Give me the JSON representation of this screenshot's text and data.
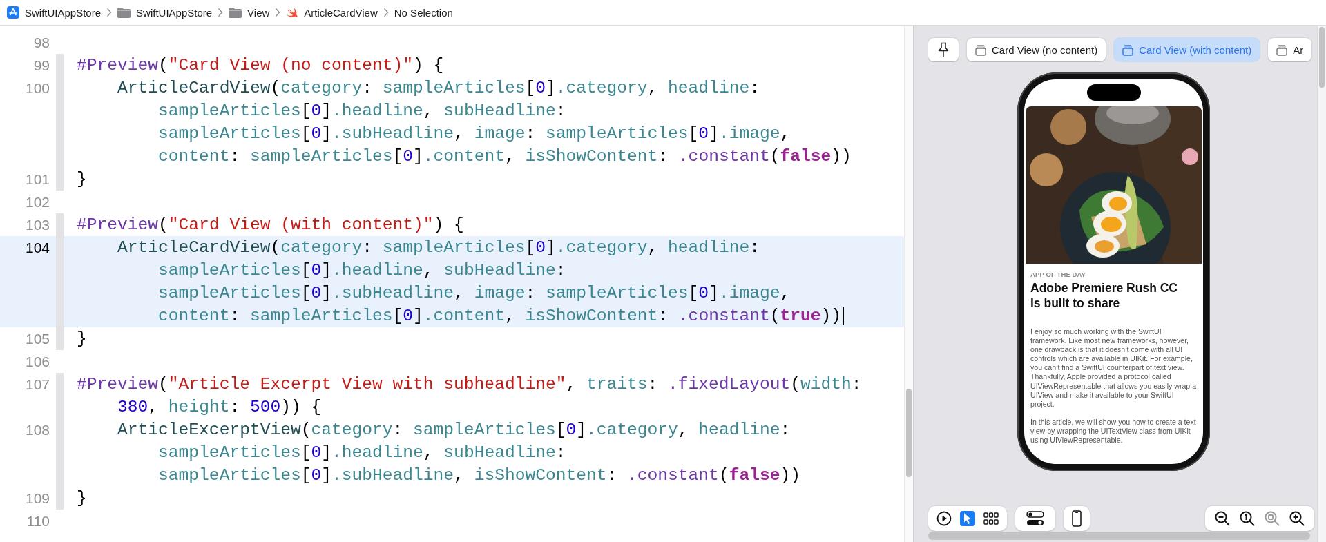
{
  "breadcrumb": [
    {
      "kind": "project",
      "label": "SwiftUIAppStore"
    },
    {
      "kind": "folder",
      "label": "SwiftUIAppStore"
    },
    {
      "kind": "folder",
      "label": "View"
    },
    {
      "kind": "swift",
      "label": "ArticleCardView"
    },
    {
      "kind": "plain",
      "label": "No Selection"
    }
  ],
  "editor": {
    "lines": [
      {
        "number": "98",
        "current": false
      },
      {
        "number": "99",
        "current": false,
        "rows": [
          "#Preview(\"Card View (no content)\") {"
        ]
      },
      {
        "number": "100",
        "current": false,
        "rows": [
          "    ArticleCardView(category: sampleArticles[0].category, headline:",
          "        sampleArticles[0].headline, subHeadline:",
          "        sampleArticles[0].subHeadline, image: sampleArticles[0].image,",
          "        content: sampleArticles[0].content, isShowContent: .constant(false))"
        ]
      },
      {
        "number": "101",
        "current": false,
        "rows": [
          "}"
        ]
      },
      {
        "number": "102",
        "current": false
      },
      {
        "number": "103",
        "current": false,
        "rows": [
          "#Preview(\"Card View (with content)\") {"
        ]
      },
      {
        "number": "104",
        "current": true,
        "rows": [
          "    ArticleCardView(category: sampleArticles[0].category, headline:",
          "        sampleArticles[0].headline, subHeadline:",
          "        sampleArticles[0].subHeadline, image: sampleArticles[0].image,",
          "        content: sampleArticles[0].content, isShowContent: .constant(true))"
        ]
      },
      {
        "number": "105",
        "current": false,
        "rows": [
          "}"
        ]
      },
      {
        "number": "106",
        "current": false
      },
      {
        "number": "107",
        "current": false,
        "rows": [
          "#Preview(\"Article Excerpt View with subheadline\", traits: .fixedLayout(width:",
          "    380, height: 500)) {"
        ]
      },
      {
        "number": "108",
        "current": false,
        "rows": [
          "    ArticleExcerptView(category: sampleArticles[0].category, headline:",
          "        sampleArticles[0].headline, subHeadline:",
          "        sampleArticles[0].subHeadline, isShowContent: .constant(false))"
        ]
      },
      {
        "number": "109",
        "current": false,
        "rows": [
          "}"
        ]
      },
      {
        "number": "110",
        "current": false
      }
    ]
  },
  "preview": {
    "tabs": [
      {
        "label": "Card View (no content)",
        "selected": false
      },
      {
        "label": "Card View (with content)",
        "selected": true
      },
      {
        "label": "Ar",
        "selected": false
      }
    ],
    "card": {
      "category": "APP OF THE DAY",
      "headline": "Adobe Premiere Rush CC is built to share",
      "paragraphs": [
        "I enjoy so much working with the SwiftUI framework. Like most new frameworks, however, one drawback is that it doesn’t come with all UI controls which are available in UIKit. For example, you can’t find a SwiftUI counterpart of text view. Thankfully, Apple provided a protocol called UIViewRepresentable that allows you easily wrap a UIView and make it available to your SwiftUI project.",
        "In this article, we will show you how to create a text view by wrapping the UITextView class from UIKit using UIViewRepresentable."
      ]
    },
    "modes": [
      {
        "kind": "live",
        "selected": false
      },
      {
        "kind": "select",
        "selected": true
      },
      {
        "kind": "variants",
        "selected": false
      }
    ],
    "zoom": [
      {
        "kind": "out",
        "disabled": false
      },
      {
        "kind": "actual",
        "disabled": false
      },
      {
        "kind": "fit",
        "disabled": true
      },
      {
        "kind": "in",
        "disabled": false
      }
    ]
  }
}
